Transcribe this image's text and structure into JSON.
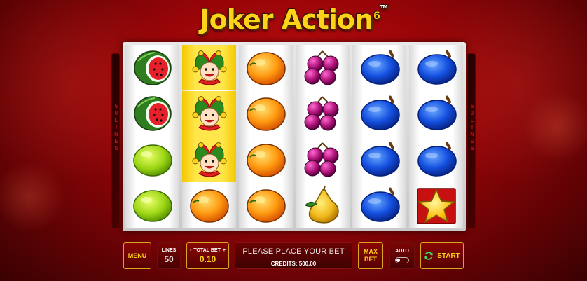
{
  "game": {
    "title": "Joker Action",
    "title_superscript": "6",
    "trademark": "TM"
  },
  "side_labels": {
    "left": [
      "5",
      "0",
      "L",
      "I",
      "N",
      "E",
      "S"
    ],
    "right": [
      "5",
      "0",
      "L",
      "I",
      "N",
      "E",
      "S"
    ]
  },
  "reels": [
    {
      "symbols": [
        "watermelon",
        "watermelon",
        "lime",
        "lime"
      ],
      "win": [
        false,
        false,
        false,
        false
      ]
    },
    {
      "symbols": [
        "joker",
        "joker",
        "joker",
        "orange"
      ],
      "win": [
        true,
        true,
        true,
        false
      ]
    },
    {
      "symbols": [
        "orange",
        "orange",
        "orange",
        "orange"
      ],
      "win": [
        false,
        false,
        false,
        false
      ]
    },
    {
      "symbols": [
        "plums",
        "plums",
        "plums",
        "pear"
      ],
      "win": [
        false,
        false,
        false,
        false
      ]
    },
    {
      "symbols": [
        "blue-plum",
        "blue-plum",
        "blue-plum",
        "blue-plum"
      ],
      "win": [
        false,
        false,
        false,
        false
      ]
    },
    {
      "symbols": [
        "blue-plum",
        "blue-plum",
        "blue-plum",
        "star"
      ],
      "win": [
        false,
        false,
        false,
        false
      ]
    }
  ],
  "controls": {
    "menu_label": "MENU",
    "lines_label": "LINES",
    "lines_value": "50",
    "total_bet_label": "TOTAL BET",
    "total_bet_minus": "-",
    "total_bet_plus": "+",
    "total_bet_value": "0.10",
    "message": "PLEASE PLACE YOUR BET",
    "credits": "CREDITS: 500.00",
    "max_bet_line1": "MAX",
    "max_bet_line2": "BET",
    "auto_label": "AUTO",
    "auto_enabled": false,
    "start_label": "START"
  },
  "colors": {
    "accent_gold": "#ffd21a",
    "background_red": "#9a0508",
    "win_highlight": "#ffe23a"
  }
}
